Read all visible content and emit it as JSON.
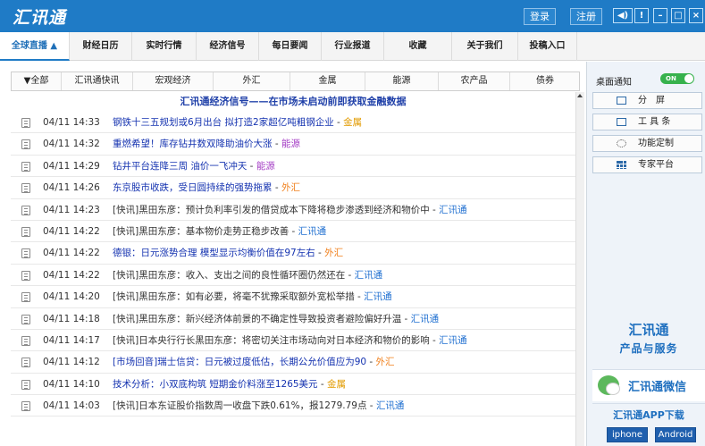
{
  "app": {
    "logo": "汇讯通",
    "login_label": "登录",
    "register_label": "注册"
  },
  "window_controls": {
    "sound": "◀)",
    "alert": "!",
    "minimize": "–",
    "maximize": "□",
    "close": "×"
  },
  "nav": {
    "items": [
      "全球直播 ▲",
      "财经日历",
      "实时行情",
      "经济信号",
      "每日要闻",
      "行业报道",
      "收藏",
      "关于我们",
      "投稿入口"
    ]
  },
  "categories": [
    "▼全部",
    "汇讯通快讯",
    "宏观经济",
    "外汇",
    "金属",
    "能源",
    "农产品",
    "债券"
  ],
  "banner": "汇讯通经济信号——在市场未启动前即获取金融数据",
  "news": [
    {
      "time": "04/11 14:33",
      "title": "钢铁十三五规划或6月出台 拟打造2家超亿吨粗钢企业",
      "tag": "金属",
      "title_color": "blue",
      "tag_color": "gold"
    },
    {
      "time": "04/11 14:32",
      "title": "重燃希望！库存钻井数双降助油价大涨",
      "tag": "能源",
      "title_color": "blue",
      "tag_color": "purple"
    },
    {
      "time": "04/11 14:29",
      "title": "钻井平台连降三周 油价一飞冲天",
      "tag": "能源",
      "title_color": "blue",
      "tag_color": "purple"
    },
    {
      "time": "04/11 14:26",
      "title": "东京股市收跌，受日圆持续的强势拖累",
      "tag": "外汇",
      "title_color": "blue",
      "tag_color": "orange"
    },
    {
      "time": "04/11 14:23",
      "title": "[快讯]黑田东彦：预计负利率引发的借贷成本下降将稳步渗透到经济和物价中",
      "tag": "汇讯通",
      "title_color": "dark",
      "tag_color": "blue"
    },
    {
      "time": "04/11 14:22",
      "title": "[快讯]黑田东彦：基本物价走势正稳步改善",
      "tag": "汇讯通",
      "title_color": "dark",
      "tag_color": "blue"
    },
    {
      "time": "04/11 14:22",
      "title": "德银：日元涨势合理 模型显示均衡价值在97左右",
      "tag": "外汇",
      "title_color": "blue",
      "tag_color": "orange"
    },
    {
      "time": "04/11 14:22",
      "title": "[快讯]黑田东彦：收入、支出之间的良性循环圈仍然还在",
      "tag": "汇讯通",
      "title_color": "dark",
      "tag_color": "blue"
    },
    {
      "time": "04/11 14:20",
      "title": "[快讯]黑田东彦：如有必要，将毫不犹豫采取额外宽松举措",
      "tag": "汇讯通",
      "title_color": "dark",
      "tag_color": "blue"
    },
    {
      "time": "04/11 14:18",
      "title": "[快讯]黑田东彦：新兴经济体前景的不确定性导致投资者避险偏好升温",
      "tag": "汇讯通",
      "title_color": "dark",
      "tag_color": "blue"
    },
    {
      "time": "04/11 14:17",
      "title": "[快讯]日本央行行长黑田东彦：将密切关注市场动向对日本经济和物价的影响",
      "tag": "汇讯通",
      "title_color": "dark",
      "tag_color": "blue"
    },
    {
      "time": "04/11 14:12",
      "title": "[市场回音]瑞士信贷：日元被过度低估，长期公允价值应为90",
      "tag": "外汇",
      "title_color": "blue",
      "tag_color": "orange"
    },
    {
      "time": "04/11 14:10",
      "title": "技术分析：小双底构筑 短期金价料涨至1265美元",
      "tag": "金属",
      "title_color": "blue",
      "tag_color": "gold"
    },
    {
      "time": "04/11 14:03",
      "title": "[快讯]日本东证股价指数周一收盘下跌0.61%，报1279.79点",
      "tag": "汇讯通",
      "title_color": "dark",
      "tag_color": "blue"
    }
  ],
  "right_panel": {
    "notify_label": "桌面通知",
    "toggle_label": "ON",
    "buttons": [
      "分　屏",
      "工 具 条",
      "功能定制",
      "专家平台"
    ]
  },
  "ads": {
    "brand": "汇讯通",
    "sub": "产品与服务",
    "wechat": "汇讯通微信",
    "app_title": "汇讯通APP下载",
    "iphone": "iphone",
    "android": "Android"
  }
}
